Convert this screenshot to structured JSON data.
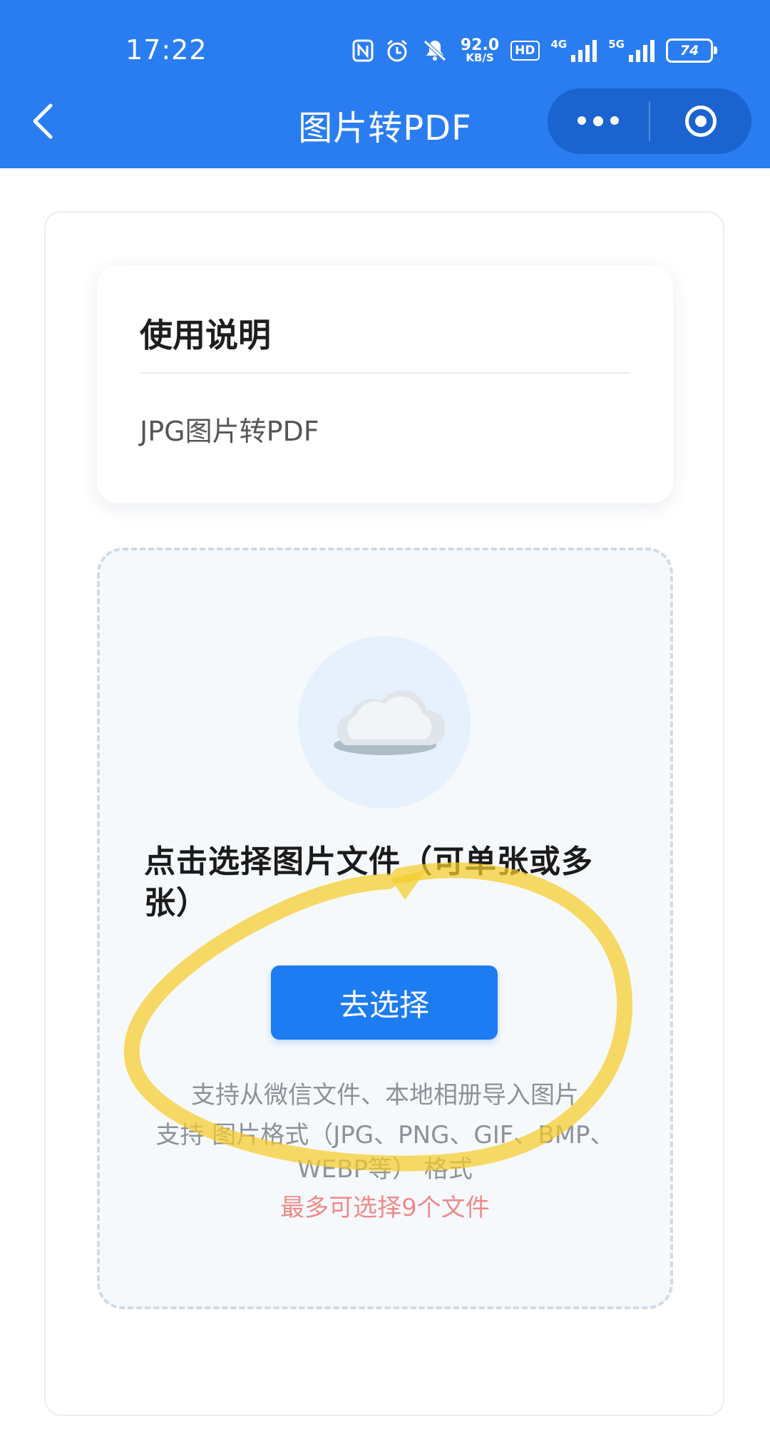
{
  "status_bar": {
    "time": "17:22",
    "net_speed": "92.0",
    "net_unit": "KB/S",
    "hd_badge": "HD",
    "signal_1_tag": "4G",
    "signal_2_tag": "5G",
    "battery": "74"
  },
  "header": {
    "title": "图片转PDF",
    "background_color": "#2a7df1"
  },
  "help_card": {
    "title": "使用说明",
    "description": "JPG图片转PDF"
  },
  "upload": {
    "heading": "点击选择图片文件（可单张或多张）",
    "button_label": "去选择",
    "support_sources": "支持从微信文件、本地相册导入图片",
    "support_formats": "支持 图片格式（JPG、PNG、GIF、BMP、WEBP等） 格式",
    "limit_note": "最多可选择9个文件",
    "accent_color": "#1d7cf2",
    "limit_color": "#f08a8a"
  },
  "icons": {
    "back": "chevron-left-icon",
    "more": "more-dots-icon",
    "close_target": "target-circle-icon",
    "upload": "cloud-icon"
  },
  "annotation": {
    "highlight_color": "#f5cc2a"
  }
}
